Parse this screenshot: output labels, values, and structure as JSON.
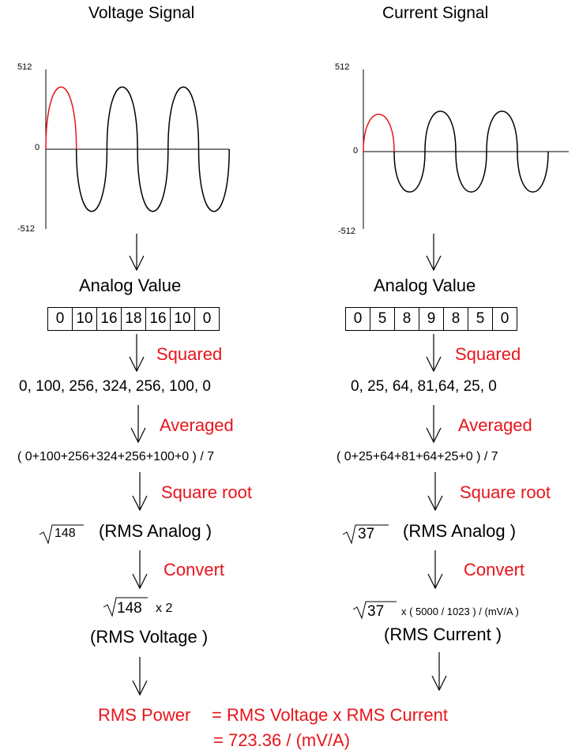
{
  "colors": {
    "highlight": "#e8141b",
    "ink": "#000000"
  },
  "voltage": {
    "title": "Voltage Signal",
    "axis": {
      "max_label": "512",
      "zero_label": "0",
      "min_label": "-512"
    },
    "wave": {
      "amplitude_first": 400,
      "amplitude_rest": 400,
      "half_cycles": 6
    },
    "analog_label": "Analog Value",
    "analog_values": [
      "0",
      "10",
      "16",
      "18",
      "16",
      "10",
      "0"
    ],
    "squared_label": "Squared",
    "squared_values": "0, 100, 256, 324, 256, 100, 0",
    "averaged_label": "Averaged",
    "averaged_expr": "( 0+100+256+324+256+100+0 ) / 7",
    "sqrt_label": "Square root",
    "rms_sqrt_value": "148",
    "rms_analog_label": "(RMS Analog )",
    "convert_label": "Convert",
    "convert_sqrt_value": "148",
    "convert_factor": "x 2",
    "rms_result_label": "(RMS Voltage )"
  },
  "current": {
    "title": "Current Signal",
    "axis": {
      "max_label": "512",
      "zero_label": "0",
      "min_label": "-512"
    },
    "wave": {
      "amplitude_first": 240,
      "amplitude_rest": 260,
      "half_cycles": 6
    },
    "analog_label": "Analog Value",
    "analog_values": [
      "0",
      "5",
      "8",
      "9",
      "8",
      "5",
      "0"
    ],
    "squared_label": "Squared",
    "squared_values": "0, 25, 64, 81,64, 25, 0",
    "averaged_label": "Averaged",
    "averaged_expr": "( 0+25+64+81+64+25+0 ) / 7",
    "sqrt_label": "Square root",
    "rms_sqrt_value": "37",
    "rms_analog_label": "(RMS Analog )",
    "convert_label": "Convert",
    "convert_sqrt_value": "37",
    "convert_factor": "x ( 5000 / 1023 ) / (mV/A )",
    "rms_result_label": "(RMS Current )"
  },
  "power": {
    "label": "RMS Power",
    "equation": "= RMS Voltage x RMS Current",
    "result": "= 723.36 / (mV/A)"
  }
}
